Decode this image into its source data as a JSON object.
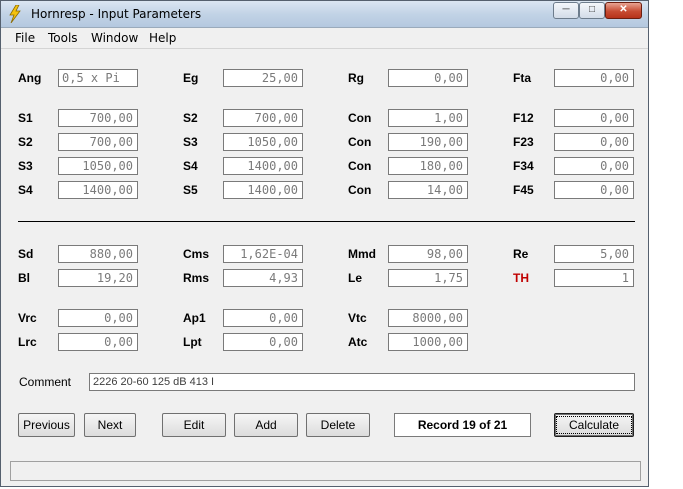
{
  "window": {
    "title": "Hornresp - Input Parameters"
  },
  "menu": [
    "File",
    "Tools",
    "Window",
    "Help"
  ],
  "rows": [
    {
      "cells": [
        {
          "label": "Ang",
          "value": "0,5 x Pi",
          "align": "left"
        },
        {
          "label": "Eg",
          "value": "25,00"
        },
        {
          "label": "Rg",
          "value": "0,00"
        },
        {
          "label": "Fta",
          "value": "0,00"
        }
      ]
    },
    {
      "cells": [
        {
          "label": "S1",
          "value": "700,00"
        },
        {
          "label": "S2",
          "value": "700,00"
        },
        {
          "label": "Con",
          "value": "1,00"
        },
        {
          "label": "F12",
          "value": "0,00"
        }
      ]
    },
    {
      "cells": [
        {
          "label": "S2",
          "value": "700,00"
        },
        {
          "label": "S3",
          "value": "1050,00"
        },
        {
          "label": "Con",
          "value": "190,00"
        },
        {
          "label": "F23",
          "value": "0,00"
        }
      ]
    },
    {
      "cells": [
        {
          "label": "S3",
          "value": "1050,00"
        },
        {
          "label": "S4",
          "value": "1400,00"
        },
        {
          "label": "Con",
          "value": "180,00"
        },
        {
          "label": "F34",
          "value": "0,00"
        }
      ]
    },
    {
      "cells": [
        {
          "label": "S4",
          "value": "1400,00"
        },
        {
          "label": "S5",
          "value": "1400,00"
        },
        {
          "label": "Con",
          "value": "14,00"
        },
        {
          "label": "F45",
          "value": "0,00"
        }
      ]
    },
    {
      "cells": [
        {
          "label": "Sd",
          "value": "880,00"
        },
        {
          "label": "Cms",
          "value": "1,62E-04"
        },
        {
          "label": "Mmd",
          "value": "98,00"
        },
        {
          "label": "Re",
          "value": "5,00"
        }
      ]
    },
    {
      "cells": [
        {
          "label": "Bl",
          "value": "19,20"
        },
        {
          "label": "Rms",
          "value": "4,93"
        },
        {
          "label": "Le",
          "value": "1,75"
        },
        {
          "label": "TH",
          "value": "1",
          "highlight": "#c00000"
        }
      ]
    },
    {
      "cells": [
        {
          "label": "Vrc",
          "value": "0,00"
        },
        {
          "label": "Ap1",
          "value": "0,00"
        },
        {
          "label": "Vtc",
          "value": "8000,00"
        }
      ]
    },
    {
      "cells": [
        {
          "label": "Lrc",
          "value": "0,00"
        },
        {
          "label": "Lpt",
          "value": "0,00"
        },
        {
          "label": "Atc",
          "value": "1000,00"
        }
      ]
    }
  ],
  "comment": {
    "label": "Comment",
    "value": "2226 20-60 125 dB 413 I"
  },
  "buttons": [
    "Previous",
    "Next",
    "Edit",
    "Add",
    "Delete",
    "Calculate"
  ],
  "record": "Record 19 of 21",
  "colors": {
    "title_gradient": "#c2d3e6",
    "warning_label": "#c00000"
  }
}
